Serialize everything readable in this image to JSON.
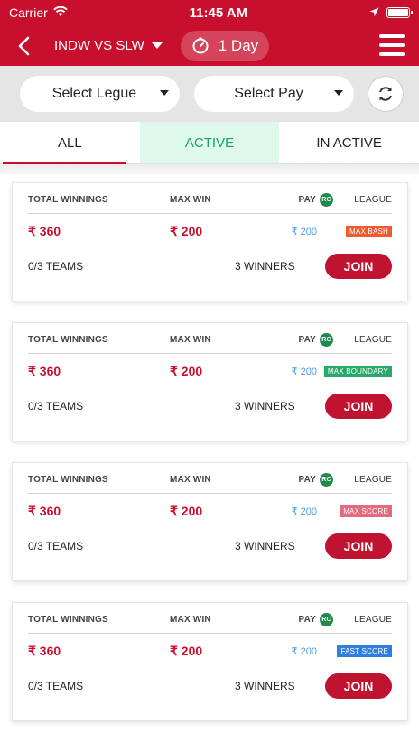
{
  "status": {
    "carrier": "Carrier",
    "time": "11:45 AM"
  },
  "nav": {
    "match": "INDW VS SLW",
    "duration": "1 Day"
  },
  "filters": {
    "league_select": "Select Legue",
    "pay_select": "Select Pay"
  },
  "tabs": [
    {
      "label": "ALL"
    },
    {
      "label": "ACTIVE"
    },
    {
      "label": "IN ACTIVE"
    }
  ],
  "headers": {
    "total": "TOTAL WINNINGS",
    "maxwin": "MAX WIN",
    "pay": "PAY",
    "rc": "RC",
    "league": "LEAGUE"
  },
  "cards": [
    {
      "total": "₹ 360",
      "maxwin": "₹ 200",
      "pay": "₹ 200",
      "league": "MAX BASH",
      "league_color": "#ef5a2f",
      "teams": "0/3 TEAMS",
      "winners": "3 WINNERS",
      "join": "JOIN"
    },
    {
      "total": "₹ 360",
      "maxwin": "₹ 200",
      "pay": "₹ 200",
      "league": "MAX BOUNDARY",
      "league_color": "#2aa868",
      "teams": "0/3 TEAMS",
      "winners": "3 WINNERS",
      "join": "JOIN"
    },
    {
      "total": "₹ 360",
      "maxwin": "₹ 200",
      "pay": "₹ 200",
      "league": "MAX SCORE",
      "league_color": "#e36a7f",
      "teams": "0/3 TEAMS",
      "winners": "3 WINNERS",
      "join": "JOIN"
    },
    {
      "total": "₹ 360",
      "maxwin": "₹ 200",
      "pay": "₹ 200",
      "league": "FAST SCORE",
      "league_color": "#2f7fe0",
      "teams": "0/3 TEAMS",
      "winners": "3 WINNERS",
      "join": "JOIN"
    }
  ],
  "colors": {
    "brand": "#c8102e",
    "active_tab_bg": "#dff8ec",
    "active_tab_text": "#19a463",
    "pay_value": "#4a9de0"
  }
}
